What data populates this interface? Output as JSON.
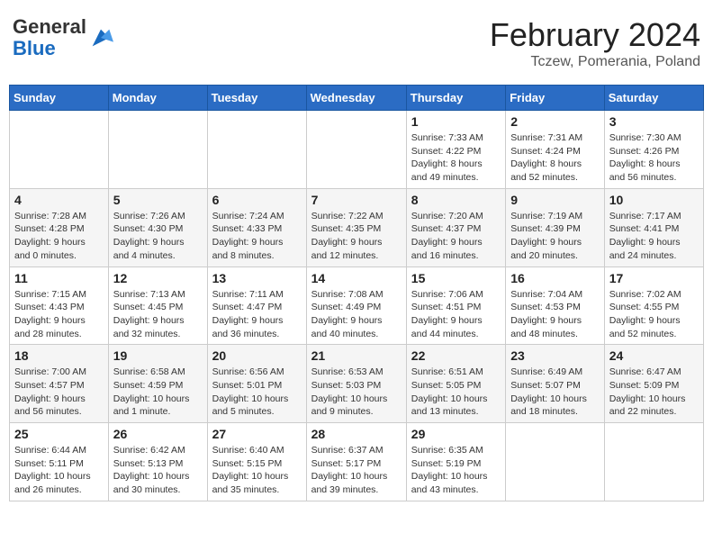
{
  "header": {
    "logo_general": "General",
    "logo_blue": "Blue",
    "month_year": "February 2024",
    "location": "Tczew, Pomerania, Poland"
  },
  "calendar": {
    "days_of_week": [
      "Sunday",
      "Monday",
      "Tuesday",
      "Wednesday",
      "Thursday",
      "Friday",
      "Saturday"
    ],
    "weeks": [
      [
        {
          "day": "",
          "info": ""
        },
        {
          "day": "",
          "info": ""
        },
        {
          "day": "",
          "info": ""
        },
        {
          "day": "",
          "info": ""
        },
        {
          "day": "1",
          "info": "Sunrise: 7:33 AM\nSunset: 4:22 PM\nDaylight: 8 hours\nand 49 minutes."
        },
        {
          "day": "2",
          "info": "Sunrise: 7:31 AM\nSunset: 4:24 PM\nDaylight: 8 hours\nand 52 minutes."
        },
        {
          "day": "3",
          "info": "Sunrise: 7:30 AM\nSunset: 4:26 PM\nDaylight: 8 hours\nand 56 minutes."
        }
      ],
      [
        {
          "day": "4",
          "info": "Sunrise: 7:28 AM\nSunset: 4:28 PM\nDaylight: 9 hours\nand 0 minutes."
        },
        {
          "day": "5",
          "info": "Sunrise: 7:26 AM\nSunset: 4:30 PM\nDaylight: 9 hours\nand 4 minutes."
        },
        {
          "day": "6",
          "info": "Sunrise: 7:24 AM\nSunset: 4:33 PM\nDaylight: 9 hours\nand 8 minutes."
        },
        {
          "day": "7",
          "info": "Sunrise: 7:22 AM\nSunset: 4:35 PM\nDaylight: 9 hours\nand 12 minutes."
        },
        {
          "day": "8",
          "info": "Sunrise: 7:20 AM\nSunset: 4:37 PM\nDaylight: 9 hours\nand 16 minutes."
        },
        {
          "day": "9",
          "info": "Sunrise: 7:19 AM\nSunset: 4:39 PM\nDaylight: 9 hours\nand 20 minutes."
        },
        {
          "day": "10",
          "info": "Sunrise: 7:17 AM\nSunset: 4:41 PM\nDaylight: 9 hours\nand 24 minutes."
        }
      ],
      [
        {
          "day": "11",
          "info": "Sunrise: 7:15 AM\nSunset: 4:43 PM\nDaylight: 9 hours\nand 28 minutes."
        },
        {
          "day": "12",
          "info": "Sunrise: 7:13 AM\nSunset: 4:45 PM\nDaylight: 9 hours\nand 32 minutes."
        },
        {
          "day": "13",
          "info": "Sunrise: 7:11 AM\nSunset: 4:47 PM\nDaylight: 9 hours\nand 36 minutes."
        },
        {
          "day": "14",
          "info": "Sunrise: 7:08 AM\nSunset: 4:49 PM\nDaylight: 9 hours\nand 40 minutes."
        },
        {
          "day": "15",
          "info": "Sunrise: 7:06 AM\nSunset: 4:51 PM\nDaylight: 9 hours\nand 44 minutes."
        },
        {
          "day": "16",
          "info": "Sunrise: 7:04 AM\nSunset: 4:53 PM\nDaylight: 9 hours\nand 48 minutes."
        },
        {
          "day": "17",
          "info": "Sunrise: 7:02 AM\nSunset: 4:55 PM\nDaylight: 9 hours\nand 52 minutes."
        }
      ],
      [
        {
          "day": "18",
          "info": "Sunrise: 7:00 AM\nSunset: 4:57 PM\nDaylight: 9 hours\nand 56 minutes."
        },
        {
          "day": "19",
          "info": "Sunrise: 6:58 AM\nSunset: 4:59 PM\nDaylight: 10 hours\nand 1 minute."
        },
        {
          "day": "20",
          "info": "Sunrise: 6:56 AM\nSunset: 5:01 PM\nDaylight: 10 hours\nand 5 minutes."
        },
        {
          "day": "21",
          "info": "Sunrise: 6:53 AM\nSunset: 5:03 PM\nDaylight: 10 hours\nand 9 minutes."
        },
        {
          "day": "22",
          "info": "Sunrise: 6:51 AM\nSunset: 5:05 PM\nDaylight: 10 hours\nand 13 minutes."
        },
        {
          "day": "23",
          "info": "Sunrise: 6:49 AM\nSunset: 5:07 PM\nDaylight: 10 hours\nand 18 minutes."
        },
        {
          "day": "24",
          "info": "Sunrise: 6:47 AM\nSunset: 5:09 PM\nDaylight: 10 hours\nand 22 minutes."
        }
      ],
      [
        {
          "day": "25",
          "info": "Sunrise: 6:44 AM\nSunset: 5:11 PM\nDaylight: 10 hours\nand 26 minutes."
        },
        {
          "day": "26",
          "info": "Sunrise: 6:42 AM\nSunset: 5:13 PM\nDaylight: 10 hours\nand 30 minutes."
        },
        {
          "day": "27",
          "info": "Sunrise: 6:40 AM\nSunset: 5:15 PM\nDaylight: 10 hours\nand 35 minutes."
        },
        {
          "day": "28",
          "info": "Sunrise: 6:37 AM\nSunset: 5:17 PM\nDaylight: 10 hours\nand 39 minutes."
        },
        {
          "day": "29",
          "info": "Sunrise: 6:35 AM\nSunset: 5:19 PM\nDaylight: 10 hours\nand 43 minutes."
        },
        {
          "day": "",
          "info": ""
        },
        {
          "day": "",
          "info": ""
        }
      ]
    ]
  }
}
